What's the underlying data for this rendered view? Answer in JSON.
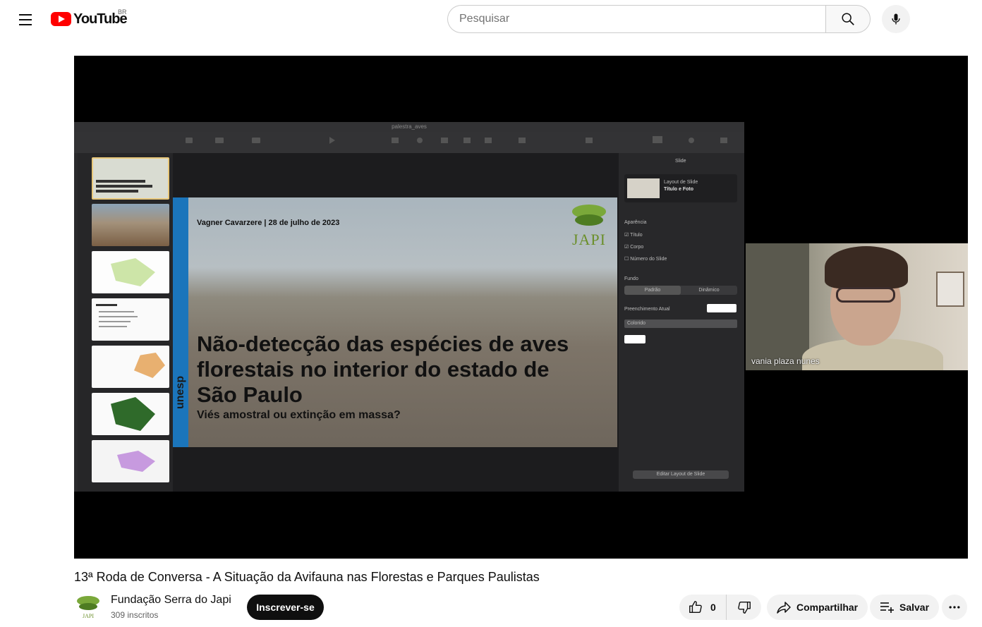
{
  "header": {
    "logo_text": "YouTube",
    "country_code": "BR",
    "search_placeholder": "Pesquisar"
  },
  "video": {
    "title": "13ª Roda de Conversa - A Situação da Avifauna nas Florestas e Parques Paulistas",
    "keynote_window_title": "palestra_aves",
    "slide": {
      "author_line": "Vagner Cavarzere | 28 de julho de 2023",
      "title": "Não-detecção das espécies de aves florestais no interior do estado de São Paulo",
      "subtitle": "Viés amostral ou extinção em massa?",
      "strip_text": "unesp",
      "logo_text": "JAPI"
    },
    "inspector": {
      "tab": "Slide",
      "layout_label": "Layout de Slide",
      "layout_value": "Título e Foto",
      "appearance": "Aparência",
      "opt_title": "Título",
      "opt_body": "Corpo",
      "opt_number": "Número do Slide",
      "background": "Fundo",
      "bg_standard": "Padrão",
      "bg_dynamic": "Dinâmico",
      "fill_label": "Preenchimento Atual",
      "fill_type": "Colorido",
      "edit_layout": "Editar Layout de Slide"
    },
    "participant_name": "vania plaza nunes"
  },
  "channel": {
    "name": "Fundação Serra do Japi",
    "subscribers": "309 inscritos",
    "subscribe_label": "Inscrever-se",
    "avatar_text": "JAPI"
  },
  "actions": {
    "like_count": "0",
    "share_label": "Compartilhar",
    "save_label": "Salvar"
  },
  "colors": {
    "brand_red": "#ff0000",
    "unesp_blue": "#1b75bb",
    "japi_green": "#6b8f2a"
  }
}
